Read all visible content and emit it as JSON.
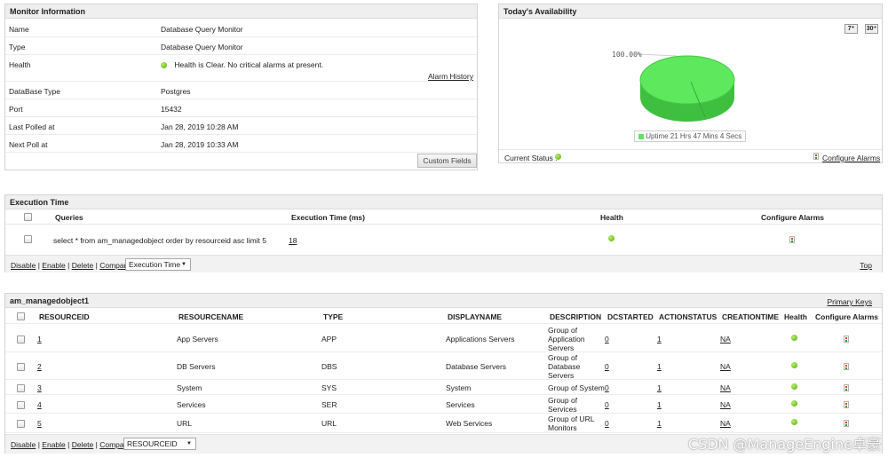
{
  "monitor": {
    "title": "Monitor Information",
    "rows": [
      {
        "label": "Name",
        "value": "Database Query Monitor"
      },
      {
        "label": "Type",
        "value": "Database Query Monitor"
      },
      {
        "label": "Health",
        "value": "Health is Clear. No critical alarms at present."
      },
      {
        "label": "DataBase Type",
        "value": "Postgres"
      },
      {
        "label": "Port",
        "value": "15432"
      },
      {
        "label": "Last Polled at",
        "value": "Jan 28, 2019 10:28 AM"
      },
      {
        "label": "Next Poll at",
        "value": "Jan 28, 2019 10:33 AM"
      }
    ],
    "alarm_history": "Alarm History",
    "custom_fields": "Custom Fields"
  },
  "availability": {
    "title": "Today's Availability",
    "btn_7": "7",
    "btn_30": "30",
    "pct_label": "100.00%",
    "legend": "Uptime 21 Hrs 47 Mins 4 Secs",
    "uptime_fraction": 1.0,
    "current_status": "Current Status :",
    "configure_alarms": "Configure Alarms",
    "uptime_color": "#5de85d"
  },
  "execution": {
    "title": "Execution Time",
    "headers": {
      "queries": "Queries",
      "exec_time": "Execution Time (ms)",
      "health": "Health",
      "configure": "Configure Alarms"
    },
    "row": {
      "query": "select * from am_managedobject order by resourceid asc limit 5",
      "time": "18"
    },
    "actions": {
      "disable": "Disable",
      "enable": "Enable",
      "delete": "Delete",
      "compare": "Compare"
    },
    "select_value": "Execution Time",
    "top": "Top"
  },
  "table": {
    "title": "am_managedobject1",
    "primary_keys": "Primary Keys",
    "headers": {
      "resourceid": "RESOURCEID",
      "resourcename": "RESOURCENAME",
      "type": "TYPE",
      "displayname": "DISPLAYNAME",
      "description": "DESCRIPTION",
      "dcstarted": "DCSTARTED",
      "actionstatus": "ACTIONSTATUS",
      "creationtime": "CREATIONTIME",
      "health": "Health",
      "configure": "Configure Alarms"
    },
    "rows": [
      {
        "id": "1",
        "name": "App Servers",
        "type": "APP",
        "display": "Applications Servers",
        "desc": [
          "Group of",
          "Application",
          "Servers"
        ],
        "dc": "0",
        "action": "1",
        "ct": "NA"
      },
      {
        "id": "2",
        "name": "DB Servers",
        "type": "DBS",
        "display": "Database Servers",
        "desc": [
          "Group of",
          "Database",
          "Servers"
        ],
        "dc": "0",
        "action": "1",
        "ct": "NA"
      },
      {
        "id": "3",
        "name": "System",
        "type": "SYS",
        "display": "System",
        "desc": [
          "Group of System"
        ],
        "dc": "0",
        "action": "1",
        "ct": "NA"
      },
      {
        "id": "4",
        "name": "Services",
        "type": "SER",
        "display": "Services",
        "desc": [
          "Group of",
          "Services"
        ],
        "dc": "0",
        "action": "1",
        "ct": "NA"
      },
      {
        "id": "5",
        "name": "URL",
        "type": "URL",
        "display": "Web Services",
        "desc": [
          "Group of URL",
          "Monitors"
        ],
        "dc": "0",
        "action": "1",
        "ct": "NA"
      }
    ],
    "actions": {
      "disable": "Disable",
      "enable": "Enable",
      "delete": "Delete",
      "compare": "Compare"
    },
    "select_value": "RESOURCEID"
  },
  "watermark": "CSDN @ManageEngine卓豪"
}
